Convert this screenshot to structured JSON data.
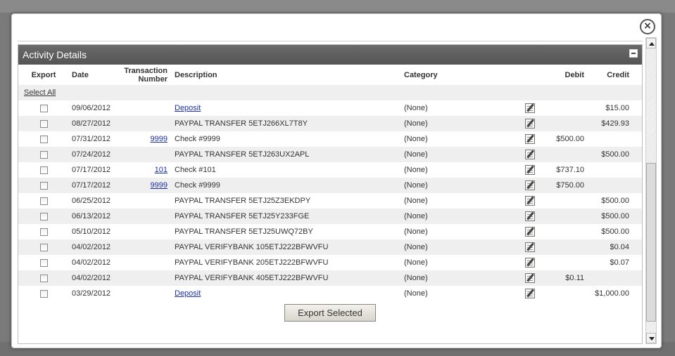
{
  "panel": {
    "title": "Activity Details"
  },
  "columns": {
    "export": "Export",
    "date": "Date",
    "transaction": "Transaction Number",
    "description": "Description",
    "category": "Category",
    "debit": "Debit",
    "credit": "Credit"
  },
  "select_all": "Select All",
  "rows": [
    {
      "date": "09/06/2012",
      "txn": "",
      "description": "Deposit",
      "desc_link": true,
      "category": "(None)",
      "debit": "",
      "credit": "$15.00"
    },
    {
      "date": "08/27/2012",
      "txn": "",
      "description": "PAYPAL TRANSFER 5ETJ266XL7T8Y",
      "desc_link": false,
      "category": "(None)",
      "debit": "",
      "credit": "$429.93"
    },
    {
      "date": "07/31/2012",
      "txn": "9999",
      "description": "Check #9999",
      "desc_link": false,
      "category": "(None)",
      "debit": "$500.00",
      "credit": ""
    },
    {
      "date": "07/24/2012",
      "txn": "",
      "description": "PAYPAL TRANSFER 5ETJ263UX2APL",
      "desc_link": false,
      "category": "(None)",
      "debit": "",
      "credit": "$500.00"
    },
    {
      "date": "07/17/2012",
      "txn": "101",
      "description": "Check #101",
      "desc_link": false,
      "category": "(None)",
      "debit": "$737.10",
      "credit": ""
    },
    {
      "date": "07/17/2012",
      "txn": "9999",
      "description": "Check #9999",
      "desc_link": false,
      "category": "(None)",
      "debit": "$750.00",
      "credit": ""
    },
    {
      "date": "06/25/2012",
      "txn": "",
      "description": "PAYPAL TRANSFER 5ETJ25Z3EKDPY",
      "desc_link": false,
      "category": "(None)",
      "debit": "",
      "credit": "$500.00"
    },
    {
      "date": "06/13/2012",
      "txn": "",
      "description": "PAYPAL TRANSFER 5ETJ25Y233FGE",
      "desc_link": false,
      "category": "(None)",
      "debit": "",
      "credit": "$500.00"
    },
    {
      "date": "05/10/2012",
      "txn": "",
      "description": "PAYPAL TRANSFER 5ETJ25UWQ72BY",
      "desc_link": false,
      "category": "(None)",
      "debit": "",
      "credit": "$500.00"
    },
    {
      "date": "04/02/2012",
      "txn": "",
      "description": "PAYPAL VERIFYBANK 105ETJ222BFWVFU",
      "desc_link": false,
      "category": "(None)",
      "debit": "",
      "credit": "$0.04"
    },
    {
      "date": "04/02/2012",
      "txn": "",
      "description": "PAYPAL VERIFYBANK 205ETJ222BFWVFU",
      "desc_link": false,
      "category": "(None)",
      "debit": "",
      "credit": "$0.07"
    },
    {
      "date": "04/02/2012",
      "txn": "",
      "description": "PAYPAL VERIFYBANK 405ETJ222BFWVFU",
      "desc_link": false,
      "category": "(None)",
      "debit": "$0.11",
      "credit": ""
    },
    {
      "date": "03/29/2012",
      "txn": "",
      "description": "Deposit",
      "desc_link": true,
      "category": "(None)",
      "debit": "",
      "credit": "$1,000.00"
    }
  ],
  "export_button": "Export Selected",
  "icons": {
    "close": "close-icon",
    "collapse": "collapse-icon",
    "edit": "edit-note-icon"
  }
}
